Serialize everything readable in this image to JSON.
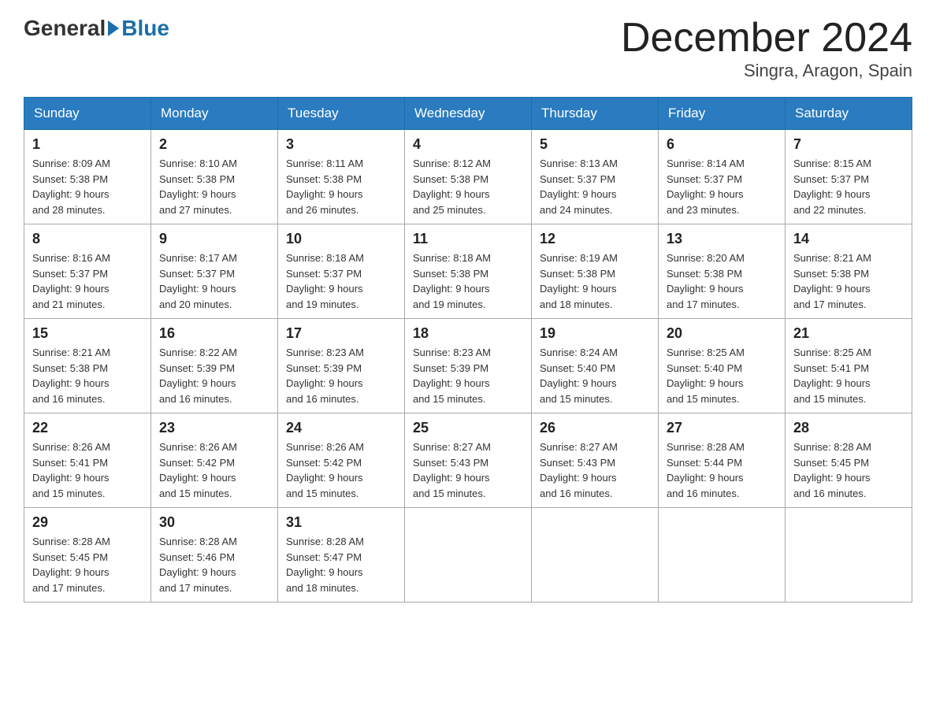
{
  "logo": {
    "general": "General",
    "blue": "Blue"
  },
  "header": {
    "month": "December 2024",
    "location": "Singra, Aragon, Spain"
  },
  "weekdays": [
    "Sunday",
    "Monday",
    "Tuesday",
    "Wednesday",
    "Thursday",
    "Friday",
    "Saturday"
  ],
  "weeks": [
    [
      {
        "day": "1",
        "sunrise": "8:09 AM",
        "sunset": "5:38 PM",
        "daylight": "9 hours and 28 minutes."
      },
      {
        "day": "2",
        "sunrise": "8:10 AM",
        "sunset": "5:38 PM",
        "daylight": "9 hours and 27 minutes."
      },
      {
        "day": "3",
        "sunrise": "8:11 AM",
        "sunset": "5:38 PM",
        "daylight": "9 hours and 26 minutes."
      },
      {
        "day": "4",
        "sunrise": "8:12 AM",
        "sunset": "5:38 PM",
        "daylight": "9 hours and 25 minutes."
      },
      {
        "day": "5",
        "sunrise": "8:13 AM",
        "sunset": "5:37 PM",
        "daylight": "9 hours and 24 minutes."
      },
      {
        "day": "6",
        "sunrise": "8:14 AM",
        "sunset": "5:37 PM",
        "daylight": "9 hours and 23 minutes."
      },
      {
        "day": "7",
        "sunrise": "8:15 AM",
        "sunset": "5:37 PM",
        "daylight": "9 hours and 22 minutes."
      }
    ],
    [
      {
        "day": "8",
        "sunrise": "8:16 AM",
        "sunset": "5:37 PM",
        "daylight": "9 hours and 21 minutes."
      },
      {
        "day": "9",
        "sunrise": "8:17 AM",
        "sunset": "5:37 PM",
        "daylight": "9 hours and 20 minutes."
      },
      {
        "day": "10",
        "sunrise": "8:18 AM",
        "sunset": "5:37 PM",
        "daylight": "9 hours and 19 minutes."
      },
      {
        "day": "11",
        "sunrise": "8:18 AM",
        "sunset": "5:38 PM",
        "daylight": "9 hours and 19 minutes."
      },
      {
        "day": "12",
        "sunrise": "8:19 AM",
        "sunset": "5:38 PM",
        "daylight": "9 hours and 18 minutes."
      },
      {
        "day": "13",
        "sunrise": "8:20 AM",
        "sunset": "5:38 PM",
        "daylight": "9 hours and 17 minutes."
      },
      {
        "day": "14",
        "sunrise": "8:21 AM",
        "sunset": "5:38 PM",
        "daylight": "9 hours and 17 minutes."
      }
    ],
    [
      {
        "day": "15",
        "sunrise": "8:21 AM",
        "sunset": "5:38 PM",
        "daylight": "9 hours and 16 minutes."
      },
      {
        "day": "16",
        "sunrise": "8:22 AM",
        "sunset": "5:39 PM",
        "daylight": "9 hours and 16 minutes."
      },
      {
        "day": "17",
        "sunrise": "8:23 AM",
        "sunset": "5:39 PM",
        "daylight": "9 hours and 16 minutes."
      },
      {
        "day": "18",
        "sunrise": "8:23 AM",
        "sunset": "5:39 PM",
        "daylight": "9 hours and 15 minutes."
      },
      {
        "day": "19",
        "sunrise": "8:24 AM",
        "sunset": "5:40 PM",
        "daylight": "9 hours and 15 minutes."
      },
      {
        "day": "20",
        "sunrise": "8:25 AM",
        "sunset": "5:40 PM",
        "daylight": "9 hours and 15 minutes."
      },
      {
        "day": "21",
        "sunrise": "8:25 AM",
        "sunset": "5:41 PM",
        "daylight": "9 hours and 15 minutes."
      }
    ],
    [
      {
        "day": "22",
        "sunrise": "8:26 AM",
        "sunset": "5:41 PM",
        "daylight": "9 hours and 15 minutes."
      },
      {
        "day": "23",
        "sunrise": "8:26 AM",
        "sunset": "5:42 PM",
        "daylight": "9 hours and 15 minutes."
      },
      {
        "day": "24",
        "sunrise": "8:26 AM",
        "sunset": "5:42 PM",
        "daylight": "9 hours and 15 minutes."
      },
      {
        "day": "25",
        "sunrise": "8:27 AM",
        "sunset": "5:43 PM",
        "daylight": "9 hours and 15 minutes."
      },
      {
        "day": "26",
        "sunrise": "8:27 AM",
        "sunset": "5:43 PM",
        "daylight": "9 hours and 16 minutes."
      },
      {
        "day": "27",
        "sunrise": "8:28 AM",
        "sunset": "5:44 PM",
        "daylight": "9 hours and 16 minutes."
      },
      {
        "day": "28",
        "sunrise": "8:28 AM",
        "sunset": "5:45 PM",
        "daylight": "9 hours and 16 minutes."
      }
    ],
    [
      {
        "day": "29",
        "sunrise": "8:28 AM",
        "sunset": "5:45 PM",
        "daylight": "9 hours and 17 minutes."
      },
      {
        "day": "30",
        "sunrise": "8:28 AM",
        "sunset": "5:46 PM",
        "daylight": "9 hours and 17 minutes."
      },
      {
        "day": "31",
        "sunrise": "8:28 AM",
        "sunset": "5:47 PM",
        "daylight": "9 hours and 18 minutes."
      },
      null,
      null,
      null,
      null
    ]
  ],
  "labels": {
    "sunrise": "Sunrise:",
    "sunset": "Sunset:",
    "daylight": "Daylight:"
  }
}
